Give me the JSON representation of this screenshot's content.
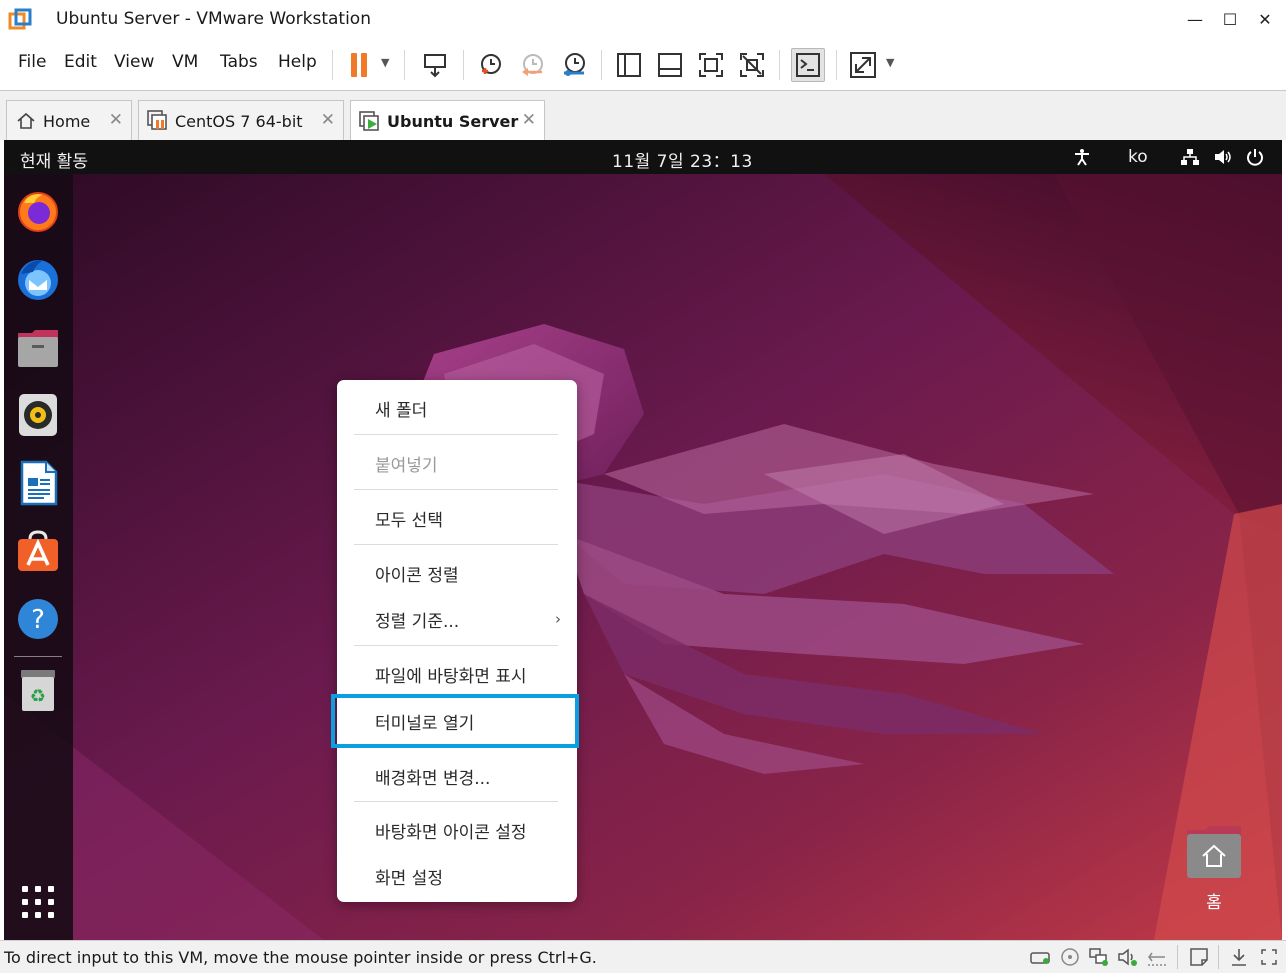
{
  "window": {
    "title": "Ubuntu Server - VMware Workstation",
    "controls": {
      "minimize": "—",
      "maximize": "☐",
      "close": "✕"
    }
  },
  "menu": {
    "items": [
      {
        "label": "File"
      },
      {
        "label": "Edit"
      },
      {
        "label": "View"
      },
      {
        "label": "VM"
      },
      {
        "label": "Tabs"
      },
      {
        "label": "Help"
      }
    ]
  },
  "toolbar": {
    "buttons": [
      "pause-icon",
      "send-ctrl-alt-del-icon",
      "snapshot-take-icon",
      "snapshot-revert-icon",
      "snapshot-manager-icon",
      "show-library-icon",
      "show-thumbnail-icon",
      "full-screen-icon",
      "unity-icon",
      "console-view-icon",
      "stretch-guest-icon"
    ]
  },
  "tabs": [
    {
      "label": "Home",
      "icon": "home-icon"
    },
    {
      "label": "CentOS 7 64-bit",
      "icon": "vm-paused-icon"
    },
    {
      "label": "Ubuntu Server",
      "icon": "vm-running-icon",
      "active": true
    }
  ],
  "gnome": {
    "activities": "현재 활동",
    "clock": "11월 7일  23：13",
    "lang": "ko"
  },
  "dock": {
    "apps": [
      "firefox-icon",
      "thunderbird-icon",
      "files-icon",
      "rhythmbox-icon",
      "libreoffice-writer-icon",
      "ubuntu-software-icon",
      "help-icon",
      "trash-icon"
    ]
  },
  "context_menu": {
    "items": [
      {
        "label": "새 폴더"
      },
      {
        "label": "붙여넣기",
        "disabled": true
      },
      {
        "label": "모두 선택"
      },
      {
        "label": "아이콘 정렬"
      },
      {
        "label": "정렬 기준...",
        "arrow": "›"
      },
      {
        "label": "파일에 바탕화면 표시"
      },
      {
        "label": "터미널로 열기",
        "highlighted": true
      },
      {
        "label": "배경화면 변경..."
      },
      {
        "label": "바탕화면 아이콘 설정"
      },
      {
        "label": "화면 설정"
      }
    ]
  },
  "desktop": {
    "home_label": "홈"
  },
  "colors": {
    "highlight": "#0aa0e0",
    "pause_orange": "#f07a2a",
    "wallpaper_base": "#5a1440"
  },
  "status": {
    "text": "To direct input to this VM, move the mouse pointer inside or press Ctrl+G."
  }
}
